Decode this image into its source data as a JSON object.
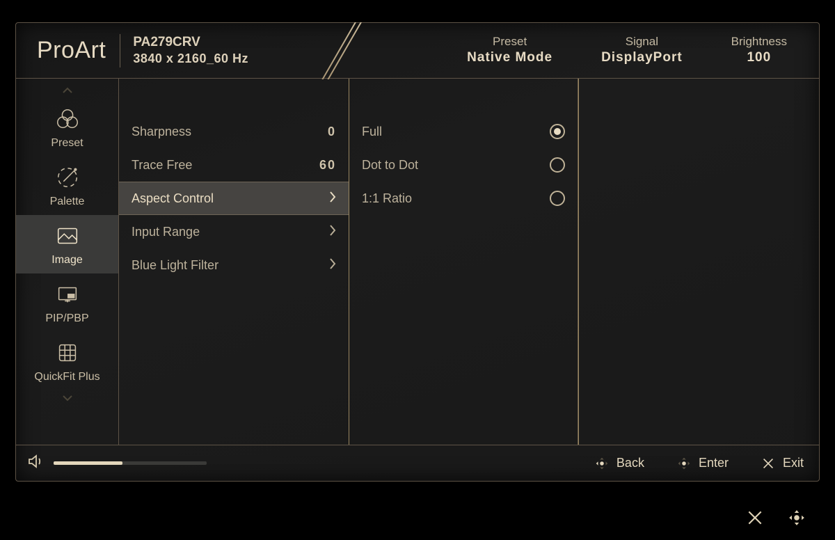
{
  "header": {
    "brand": "ProArt",
    "model_name": "PA279CRV",
    "resolution": "3840 x 2160_60 Hz",
    "info": [
      {
        "label": "Preset",
        "value": "Native Mode"
      },
      {
        "label": "Signal",
        "value": "DisplayPort"
      },
      {
        "label": "Brightness",
        "value": "100"
      }
    ]
  },
  "sidebar": {
    "items": [
      {
        "label": "Preset",
        "icon": "preset"
      },
      {
        "label": "Palette",
        "icon": "palette"
      },
      {
        "label": "Image",
        "icon": "image",
        "active": true
      },
      {
        "label": "PIP/PBP",
        "icon": "pip"
      },
      {
        "label": "QuickFit Plus",
        "icon": "grid"
      }
    ]
  },
  "panel1": {
    "rows": [
      {
        "label": "Sharpness",
        "value": "0"
      },
      {
        "label": "Trace Free",
        "value": "60"
      },
      {
        "label": "Aspect Control",
        "chevron": true,
        "selected": true
      },
      {
        "label": "Input Range",
        "chevron": true
      },
      {
        "label": "Blue Light Filter",
        "chevron": true
      }
    ]
  },
  "panel2": {
    "options": [
      {
        "label": "Full",
        "selected": true
      },
      {
        "label": "Dot to Dot",
        "selected": false
      },
      {
        "label": "1:1 Ratio",
        "selected": false
      }
    ]
  },
  "footer": {
    "volume_percent": 45,
    "buttons": {
      "back": "Back",
      "enter": "Enter",
      "exit": "Exit"
    }
  }
}
